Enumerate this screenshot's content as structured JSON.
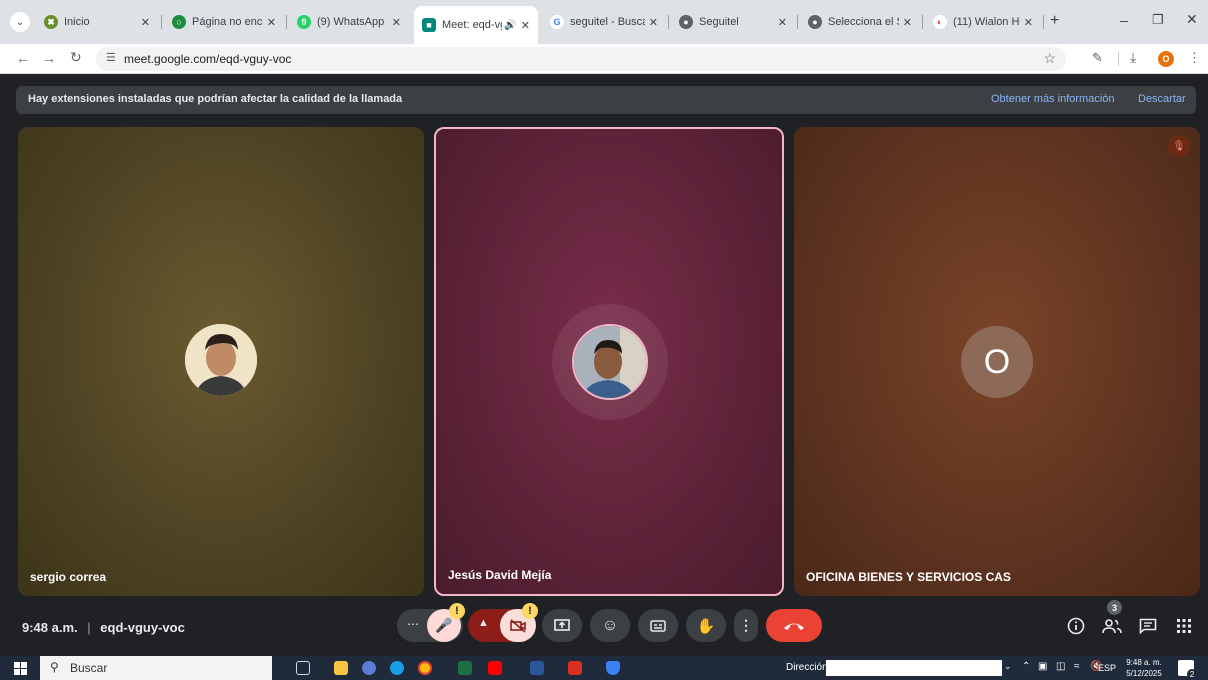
{
  "browser": {
    "tabs": [
      {
        "title": "Inicio",
        "fav": "✖",
        "favColor": "#6a8f2b"
      },
      {
        "title": "Página no encontr",
        "fav": "○",
        "favColor": "#1e8e3e"
      },
      {
        "title": "(9) WhatsApp",
        "fav": "9",
        "favColor": "#25d366"
      },
      {
        "title": "Meet: eqd-vgu",
        "fav": "■",
        "favColor": "#00897b"
      },
      {
        "title": "seguitel - Buscar c",
        "fav": "G",
        "favColor": "#4285f4"
      },
      {
        "title": "Seguitel",
        "fav": "●",
        "favColor": "#5f6368"
      },
      {
        "title": "Selecciona el Serv",
        "fav": "●",
        "favColor": "#5f6368"
      },
      {
        "title": "(11) Wialon Hostin",
        "fav": "◐",
        "favColor": "#e53935"
      }
    ],
    "new_tab": "+",
    "url": "meet.google.com/eqd-vguy-voc",
    "profile_initial": "O"
  },
  "banner": {
    "text": "Hay extensiones instaladas que podrían afectar la calidad de la llamada",
    "learn_more": "Obtener más información",
    "dismiss": "Descartar"
  },
  "participants": [
    {
      "name": "sergio correa"
    },
    {
      "name": "Jesús David Mejía"
    },
    {
      "name": "OFICINA BIENES Y SERVICIOS CAS",
      "initial": "O"
    }
  ],
  "meeting": {
    "time": "9:48 a.m.",
    "separator": "|",
    "code": "eqd-vguy-voc",
    "participant_count": "3",
    "warning": "!"
  },
  "taskbar": {
    "search_placeholder": "Buscar",
    "address_label": "Dirección",
    "lang": "ESP",
    "time": "9:48 a. m.",
    "date": "5/12/2025",
    "notif_count": "2"
  }
}
